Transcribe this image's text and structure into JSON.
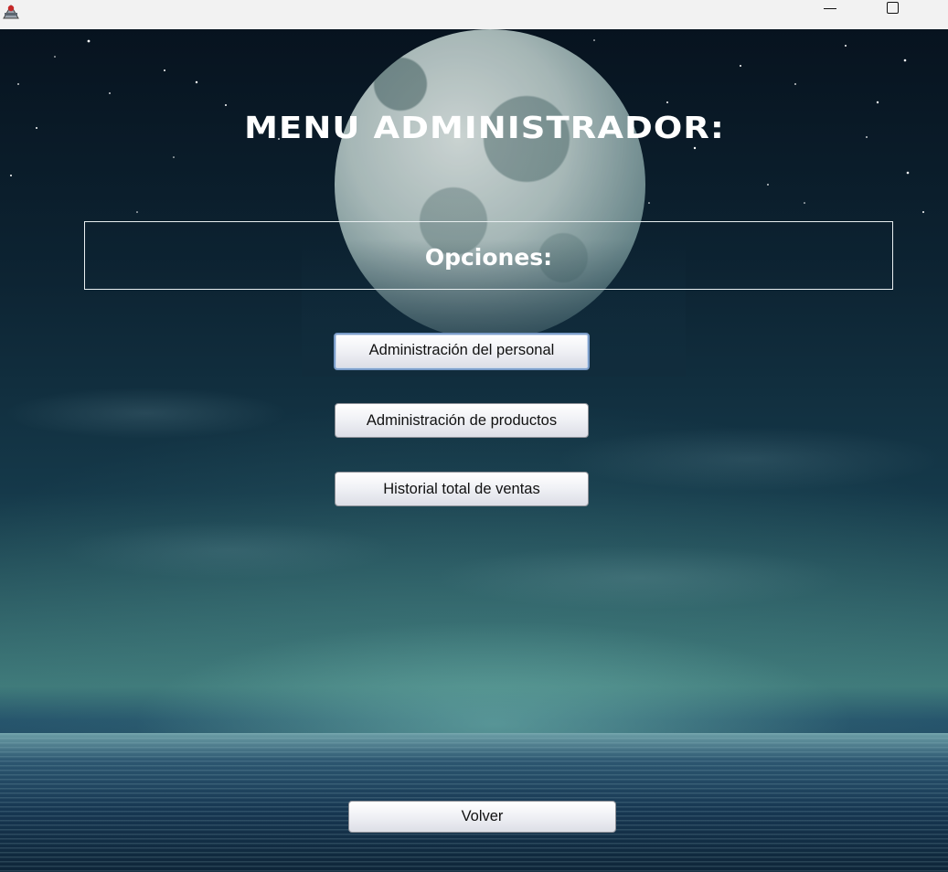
{
  "window": {
    "minimize_icon": "minimize-icon",
    "maximize_icon": "maximize-icon",
    "app_icon": "java-app-icon"
  },
  "header": {
    "title": "MENU ADMINISTRADOR:"
  },
  "options_panel": {
    "label": "Opciones:"
  },
  "menu_buttons": [
    {
      "label": "Administración del personal"
    },
    {
      "label": "Administración de productos"
    },
    {
      "label": "Historial total de ventas"
    }
  ],
  "footer": {
    "back_label": "Volver"
  },
  "colors": {
    "titlebar": "#f2f2f2",
    "sky_top": "#07131f",
    "horizon_glow": "#3f7a7a",
    "text": "#ffffff",
    "button_focus_border": "#7a9cc8"
  }
}
